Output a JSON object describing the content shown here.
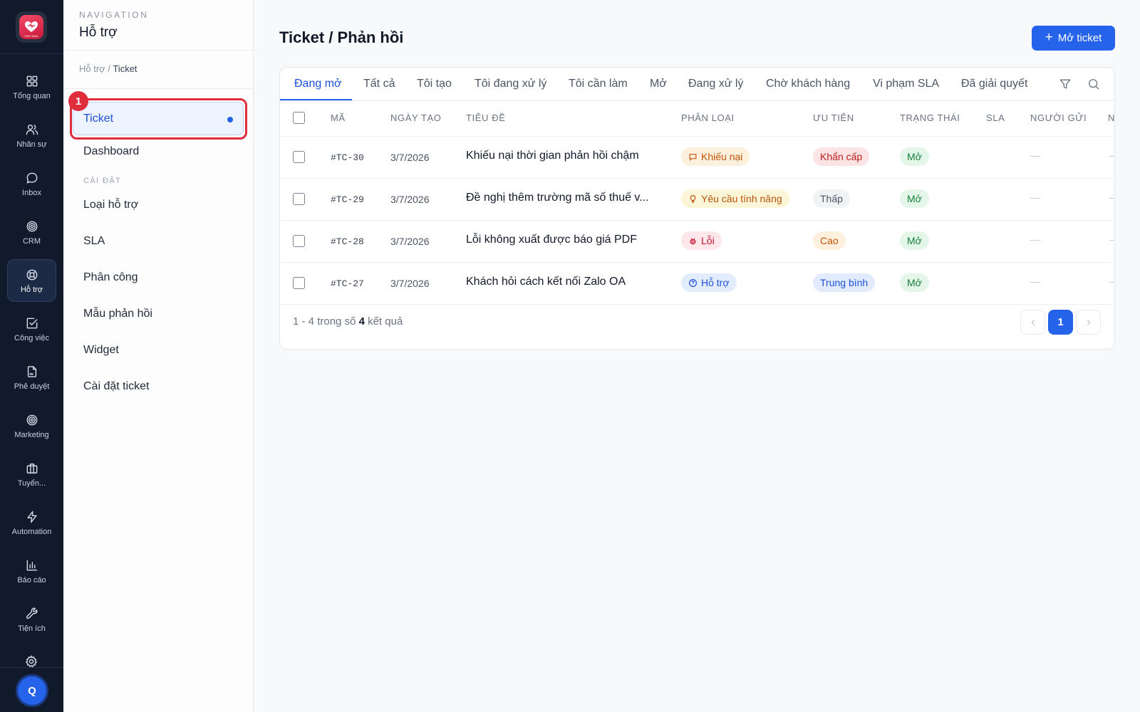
{
  "brand": {
    "logo_text": "CMV Work"
  },
  "rail": {
    "items": [
      {
        "label": "Tổng quan",
        "icon": "dashboard-grid-icon"
      },
      {
        "label": "Nhân sự",
        "icon": "users-icon"
      },
      {
        "label": "Inbox",
        "icon": "chat-bubble-icon"
      },
      {
        "label": "CRM",
        "icon": "target-icon"
      },
      {
        "label": "Hỗ trợ",
        "icon": "lifebuoy-icon"
      },
      {
        "label": "Công việc",
        "icon": "checkbox-icon"
      },
      {
        "label": "Phê duyệt",
        "icon": "file-sign-icon"
      },
      {
        "label": "Marketing",
        "icon": "target-icon"
      },
      {
        "label": "Tuyển...",
        "icon": "briefcase-icon"
      },
      {
        "label": "Automation",
        "icon": "lightning-icon"
      },
      {
        "label": "Báo cáo",
        "icon": "bar-chart-icon"
      },
      {
        "label": "Tiện ích",
        "icon": "wrench-icon"
      }
    ],
    "active_index": 4,
    "avatar_initial": "Q"
  },
  "nav": {
    "eyebrow": "NAVIGATION",
    "title": "Hỗ trợ",
    "breadcrumb_parent": "Hỗ trợ",
    "breadcrumb_sep": "/",
    "breadcrumb_current": "Ticket",
    "active_item": "Ticket",
    "highlight_badge": "1",
    "items": [
      "Dashboard"
    ],
    "section_label": "CÀI ĐẶT",
    "settings_items": [
      "Loại hỗ trợ",
      "SLA",
      "Phân công",
      "Mẫu phản hồi",
      "Widget",
      "Cài đặt ticket"
    ]
  },
  "header": {
    "title": "Ticket / Phản hồi",
    "new_button": "Mở ticket"
  },
  "tabs": [
    "Đang mở",
    "Tất cả",
    "Tôi tạo",
    "Tôi đang xử lý",
    "Tôi cần làm",
    "Mở",
    "Đang xử lý",
    "Chờ khách hàng",
    "Vi phạm SLA",
    "Đã giải quyết"
  ],
  "columns": [
    "MÃ",
    "NGÀY TẠO",
    "TIÊU ĐỀ",
    "PHÂN LOẠI",
    "ƯU TIÊN",
    "TRẠNG THÁI",
    "SLA",
    "NGƯỜI GỬI",
    "N"
  ],
  "rows": [
    {
      "code": "#TC-30",
      "date": "3/7/2026",
      "title": "Khiếu nại thời gian phản hồi chậm",
      "category": "Khiếu nại",
      "category_icon": "message-square-icon",
      "priority": "Khẩn cấp",
      "status": "Mở",
      "sender": "—"
    },
    {
      "code": "#TC-29",
      "date": "3/7/2026",
      "title": "Đề nghị thêm trường mã số thuế v...",
      "category": "Yêu cầu tính năng",
      "category_icon": "lightbulb-icon",
      "priority": "Thấp",
      "status": "Mở",
      "sender": "—"
    },
    {
      "code": "#TC-28",
      "date": "3/7/2026",
      "title": "Lỗi không xuất được báo giá PDF",
      "category": "Lỗi",
      "category_icon": "bug-icon",
      "priority": "Cao",
      "status": "Mở",
      "sender": "—"
    },
    {
      "code": "#TC-27",
      "date": "3/7/2026",
      "title": "Khách hỏi cách kết nối Zalo OA",
      "category": "Hỗ trợ",
      "category_icon": "help-circle-icon",
      "priority": "Trung bình",
      "status": "Mở",
      "sender": "—"
    }
  ],
  "pagination": {
    "range": "1 - 4",
    "of_text": "trong số",
    "total": "4",
    "suffix": "kết quả",
    "current_page": "1"
  },
  "colors": {
    "accent": "#2563eb",
    "rail_bg": "#111a2b",
    "highlight": "#e02d3c"
  }
}
